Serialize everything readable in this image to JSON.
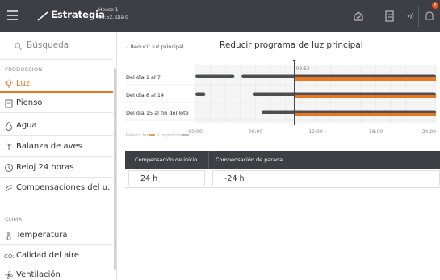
{
  "header": {
    "title": "Estrategia",
    "house": "House 1",
    "date": "09:52, Día 0",
    "notification_count": "6",
    "icons": [
      "menu-icon",
      "trend-icon",
      "house-check-icon",
      "document-icon",
      "speaker-icon",
      "bell-icon"
    ]
  },
  "sidebar": {
    "search_placeholder": "Búsqueda",
    "section1": "PRODUCCIÓN",
    "production": [
      {
        "label": "Luz",
        "icon": "bulb-icon"
      },
      {
        "label": "Pienso",
        "icon": "feed-icon"
      },
      {
        "label": "Agua",
        "icon": "water-drop-icon"
      },
      {
        "label": "Balanza de aves",
        "icon": "bird-scale-icon"
      },
      {
        "label": "Reloj 24 horas",
        "icon": "clock-icon"
      },
      {
        "label": "Compensaciones del u...",
        "icon": "compensation-icon"
      }
    ],
    "section2": "CLIMA",
    "climate": [
      {
        "label": "Temperatura",
        "icon": "thermometer-icon"
      },
      {
        "label": "Calidad del aire",
        "icon": "air-quality-icon"
      },
      {
        "label": "Ventilación",
        "icon": "ventilation-icon"
      }
    ]
  },
  "main": {
    "back_label": "Reducir luz principal",
    "title": "Reducir programa de luz principal",
    "current_time": "09:52",
    "legend": {
      "reduce": "Reducir luz",
      "main": "Luz principal"
    },
    "table": {
      "col1": "Compensación de inicio",
      "col2": "Compensación de parada",
      "start": "24 h",
      "stop": "-24 h"
    }
  },
  "chart_data": {
    "type": "timeline",
    "rows": [
      {
        "label": "Del día 1 al 7",
        "main_light": [
          [
            0,
            3.9
          ],
          [
            4.6,
            24
          ]
        ],
        "reduce_light": [
          [
            9.95,
            24
          ]
        ]
      },
      {
        "label": "Del día 8 al 14",
        "main_light": [
          [
            0,
            1
          ],
          [
            5.7,
            24
          ]
        ],
        "reduce_light": [
          [
            9.95,
            24
          ]
        ]
      },
      {
        "label": "Del día 15 al fin del lote",
        "main_light": [
          [
            6.6,
            24
          ]
        ],
        "reduce_light": [
          [
            9.95,
            24
          ]
        ]
      }
    ],
    "x_ticks": [
      "00:00",
      "06:00",
      "12:00",
      "18:00",
      "24:00"
    ],
    "xlim": [
      0,
      24
    ],
    "current": 9.87,
    "colors": {
      "main": "#4d4f52",
      "reduce": "#e87722"
    }
  },
  "colors": {
    "accent": "#e87722",
    "header": "#3c3f43"
  }
}
